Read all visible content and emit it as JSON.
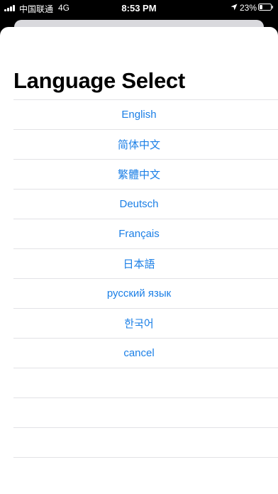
{
  "status_bar": {
    "carrier": "中国联通",
    "network": "4G",
    "time": "8:53 PM",
    "battery": "23%",
    "icons": [
      "signal-icon",
      "location-icon",
      "battery-icon"
    ]
  },
  "sheet": {
    "title": "Language Select",
    "options": [
      {
        "label": "English"
      },
      {
        "label": "简体中文"
      },
      {
        "label": "繁體中文"
      },
      {
        "label": "Deutsch"
      },
      {
        "label": "Français"
      },
      {
        "label": "日本語"
      },
      {
        "label": "русский язык"
      },
      {
        "label": "한국어"
      },
      {
        "label": "cancel"
      }
    ]
  },
  "colors": {
    "accent": "#1b7fe6",
    "separator": "#e2e2e6",
    "background": "#000000",
    "sheet": "#ffffff"
  }
}
